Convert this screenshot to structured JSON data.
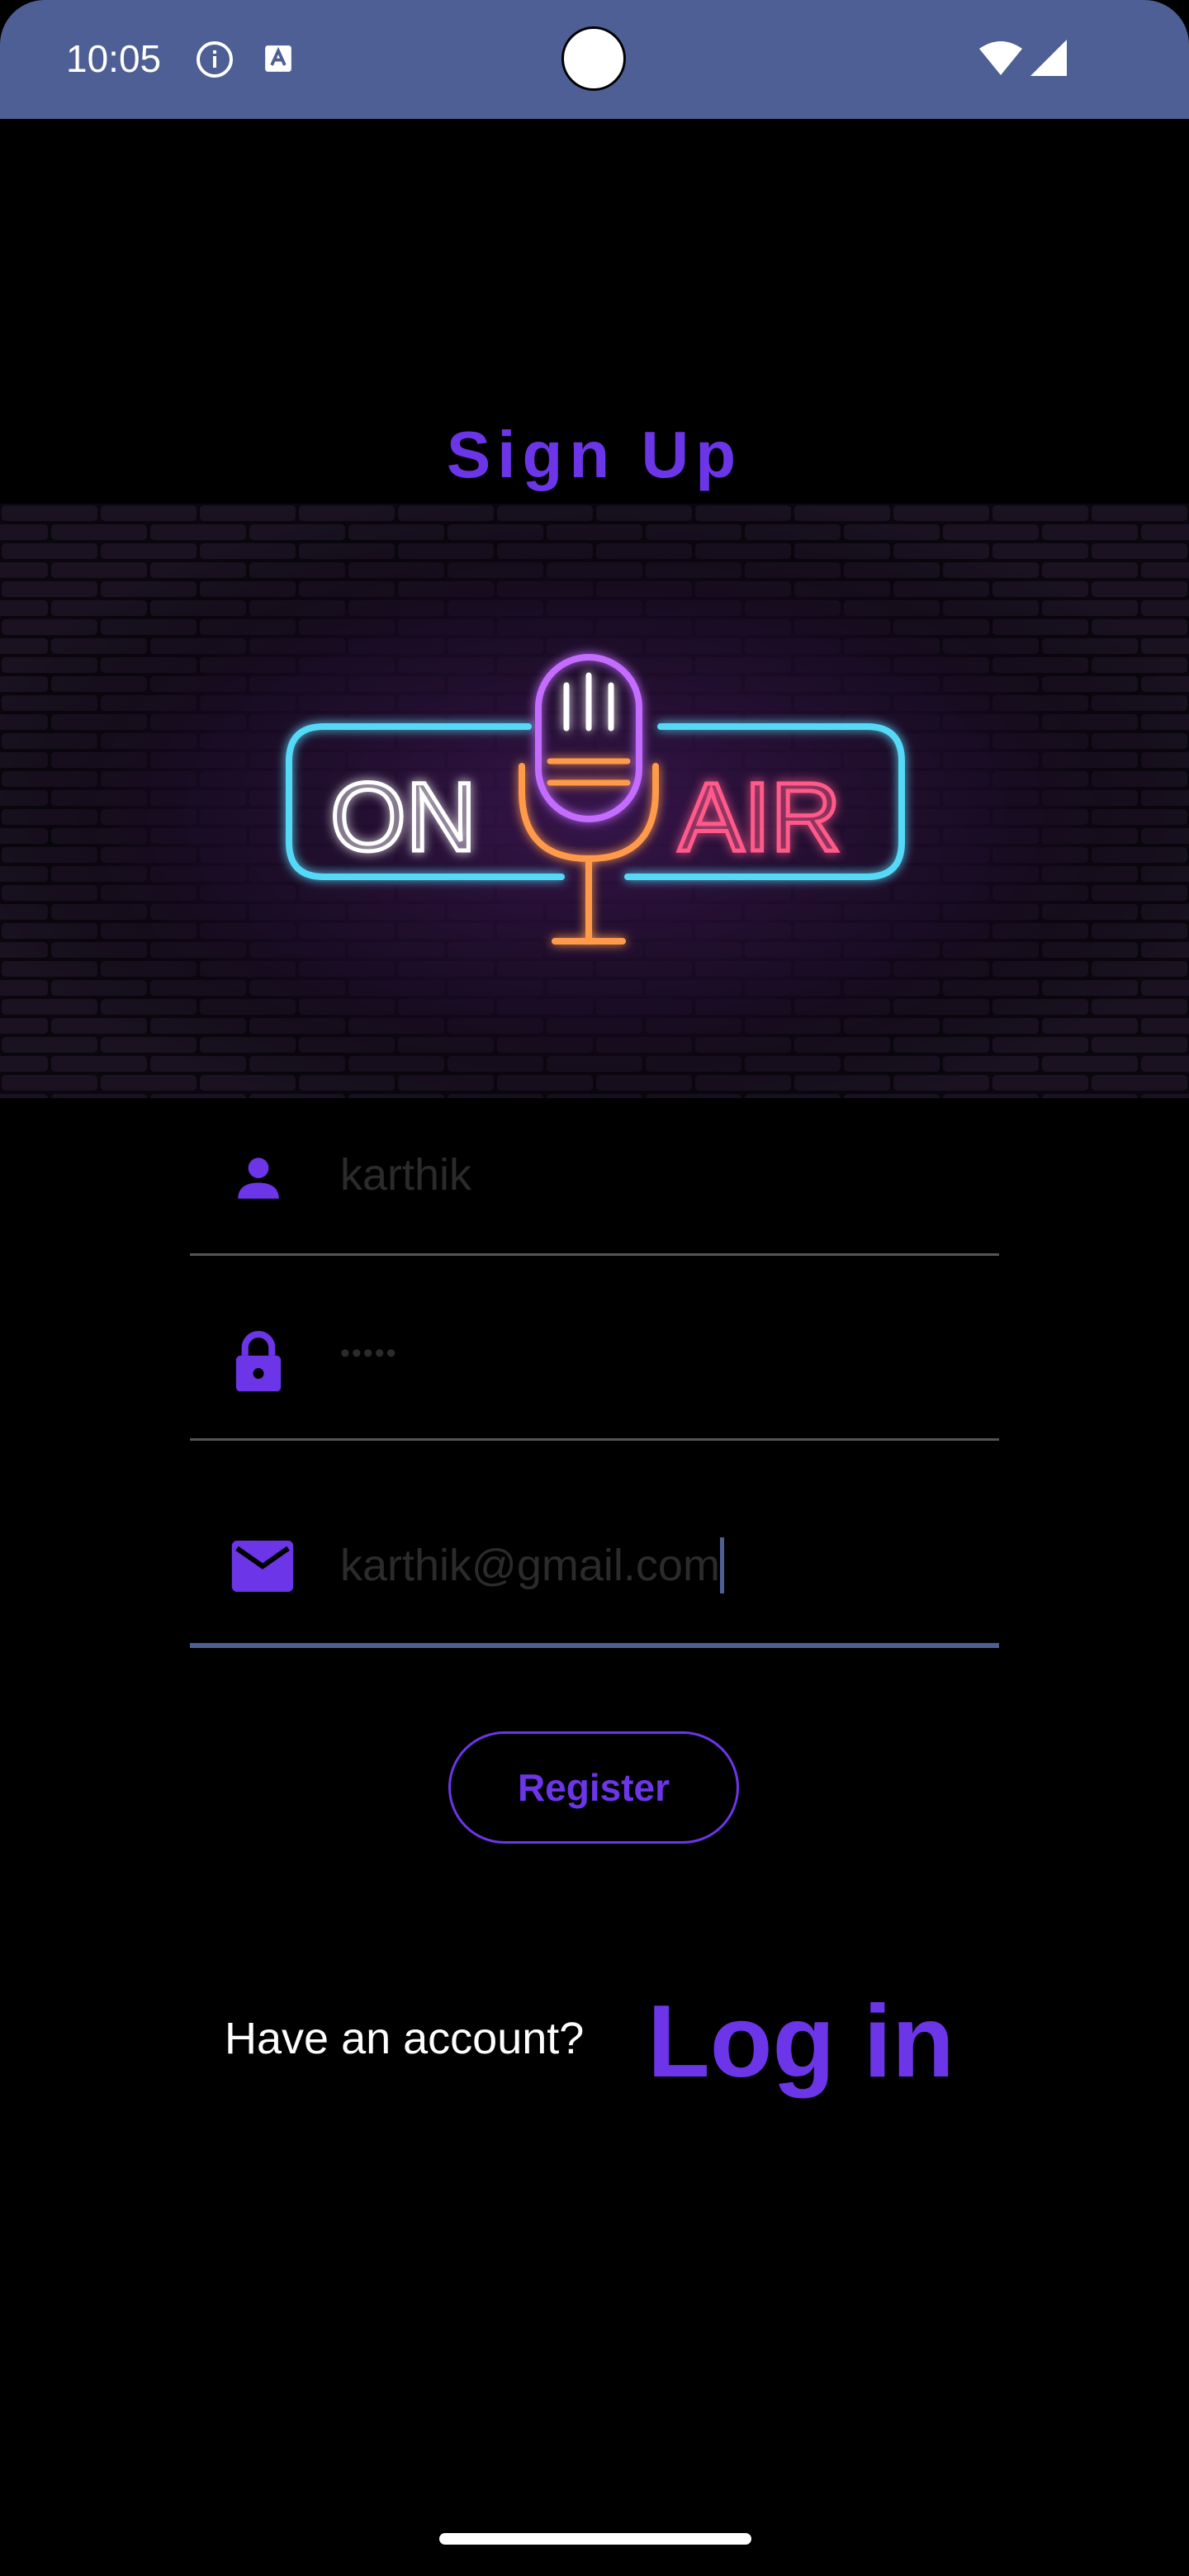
{
  "status_bar": {
    "time": "10:05",
    "icons": [
      "info-icon",
      "a-icon",
      "wifi-icon",
      "signal-icon"
    ]
  },
  "title": "Sign Up",
  "hero": {
    "left_text": "ON",
    "right_text": "AIR",
    "icon": "microphone-icon"
  },
  "form": {
    "username": {
      "value": "karthik",
      "icon": "person-icon"
    },
    "password": {
      "value": "•••••",
      "icon": "lock-icon"
    },
    "email": {
      "value": "karthik@gmail.com",
      "icon": "mail-icon"
    }
  },
  "register_label": "Register",
  "footer": {
    "prompt": "Have an account?",
    "login_label": "Log in"
  },
  "colors": {
    "accent": "#6c35e8",
    "status_bar": "#4d5f94",
    "neon_cyan": "#57d9f7",
    "neon_pink": "#ff5a8a",
    "neon_orange": "#ff9a4c",
    "neon_purple": "#c46cff"
  }
}
